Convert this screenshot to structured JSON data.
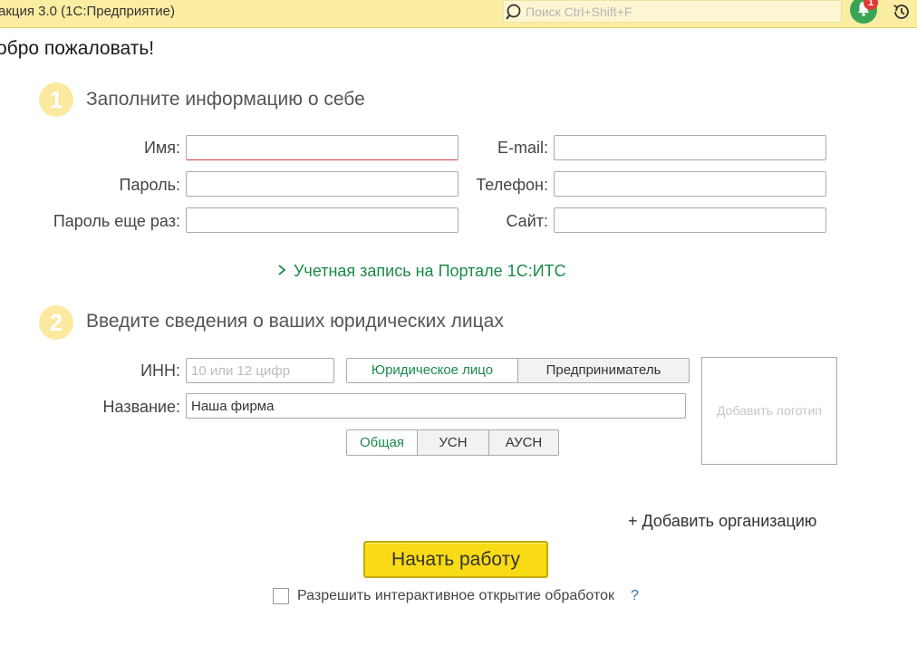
{
  "header": {
    "app_title": "акция 3.0  (1С:Предприятие)",
    "search_placeholder": "Поиск Ctrl+Shift+F",
    "notification_count": "1"
  },
  "welcome": "обро пожаловать!",
  "step1": {
    "number": "1",
    "title": "Заполните информацию о себе",
    "name_label": "Имя:",
    "password_label": "Пароль:",
    "password_repeat_label": "Пароль еще раз:",
    "email_label": "E-mail:",
    "phone_label": "Телефон:",
    "site_label": "Сайт:",
    "its_link": "Учетная запись на Портале 1С:ИТС"
  },
  "step2": {
    "number": "2",
    "title": "Введите сведения о ваших юридических лицах",
    "inn_label": "ИНН:",
    "inn_placeholder": "10 или 12 цифр",
    "entity_types": [
      "Юридическое лицо",
      "Предприниматель"
    ],
    "name_label": "Название:",
    "name_value": "Наша фирма",
    "tax_systems": [
      "Общая",
      "УСН",
      "АУСН"
    ],
    "logo_text": "Добавить логотип",
    "add_org": "+ Добавить организацию"
  },
  "start_button": "Начать работу",
  "interactive_checkbox": "Разрешить интерактивное открытие обработок",
  "help": "?",
  "colors": {
    "header_bg": "#fbeda2",
    "accent_green": "#1a8a4a",
    "start_button": "#f8da15",
    "step_circle": "#fbe9a0"
  }
}
